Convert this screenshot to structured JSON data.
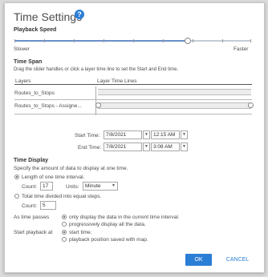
{
  "dialog": {
    "title": "Time Settings",
    "help_icon": "help-icon"
  },
  "playback": {
    "heading": "Playback Speed",
    "slower": "Slower",
    "faster": "Faster",
    "speed_fraction": 0.73
  },
  "timespan": {
    "heading": "Time Span",
    "instructions": "Drag the slider handles or click a layer time line to set the Start and End time.",
    "col_layers": "Layers",
    "col_timelines": "Layer Time Lines",
    "layers": [
      "Routes_to_Stops",
      "Routes_to_Stops - Assigne..."
    ]
  },
  "range": {
    "start_label": "Start Time:",
    "start_date": "7/8/2021",
    "start_time": "12:15 AM",
    "end_label": "End Time:",
    "end_date": "7/8/2021",
    "end_time": "3:08 AM"
  },
  "display": {
    "heading": "Time Display",
    "instructions": "Specify the amount of data to display at one time.",
    "opt_length": "Length of one time interval.",
    "count_label": "Count:",
    "count_value": "17",
    "units_label": "Units:",
    "units_value": "Minute",
    "opt_divided": "Total time divided into equal steps.",
    "count2_label": "Count:",
    "count2_value": "5",
    "as_time_passes": "As time passes",
    "only_display": "only display the data in the current time interval.",
    "progressively": "progressively display all the data.",
    "start_playback_at": "Start playback at",
    "start_time": "start time.",
    "saved_position": "playback position saved with map."
  },
  "buttons": {
    "ok": "OK",
    "cancel": "CANCEL"
  },
  "colors": {
    "accent": "#2b7ed6"
  }
}
